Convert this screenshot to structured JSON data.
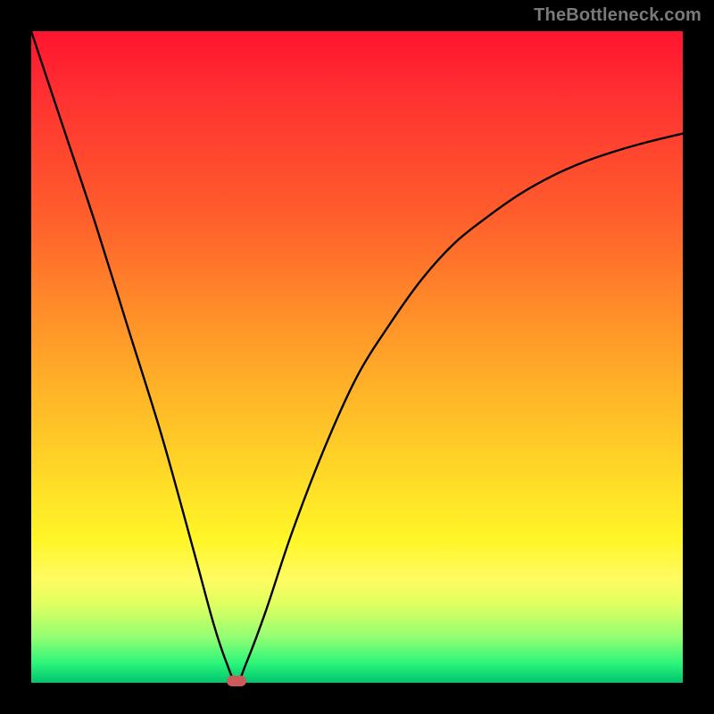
{
  "watermark": {
    "text": "TheBottleneck.com"
  },
  "chart_data": {
    "type": "line",
    "title": "",
    "xlabel": "",
    "ylabel": "",
    "xlim": [
      0,
      100
    ],
    "ylim": [
      0,
      100
    ],
    "grid": false,
    "legend": false,
    "series": [
      {
        "name": "bottleneck-curve",
        "x": [
          0,
          5,
          10,
          15,
          20,
          25,
          28,
          30,
          31.5,
          33,
          36,
          40,
          45,
          50,
          55,
          60,
          65,
          70,
          75,
          80,
          85,
          90,
          95,
          100
        ],
        "values": [
          100,
          85,
          70,
          54,
          38,
          20,
          9,
          3,
          0,
          3,
          11,
          23,
          36,
          47,
          55,
          62,
          67.5,
          71.5,
          75,
          77.8,
          80,
          81.7,
          83.1,
          84.3
        ]
      }
    ],
    "marker": {
      "x": 31.5,
      "y": 0,
      "color": "#cc5a5a"
    },
    "background_gradient": {
      "stops": [
        {
          "pos": 0,
          "color": "#ff1430"
        },
        {
          "pos": 10,
          "color": "#ff3131"
        },
        {
          "pos": 28,
          "color": "#ff5d2c"
        },
        {
          "pos": 42,
          "color": "#ff8a29"
        },
        {
          "pos": 55,
          "color": "#ffb327"
        },
        {
          "pos": 68,
          "color": "#ffd927"
        },
        {
          "pos": 78,
          "color": "#fff627"
        },
        {
          "pos": 84,
          "color": "#fffb61"
        },
        {
          "pos": 88,
          "color": "#dfff60"
        },
        {
          "pos": 93,
          "color": "#93ff73"
        },
        {
          "pos": 97,
          "color": "#2cf57a"
        },
        {
          "pos": 100,
          "color": "#00c46e"
        }
      ]
    }
  }
}
